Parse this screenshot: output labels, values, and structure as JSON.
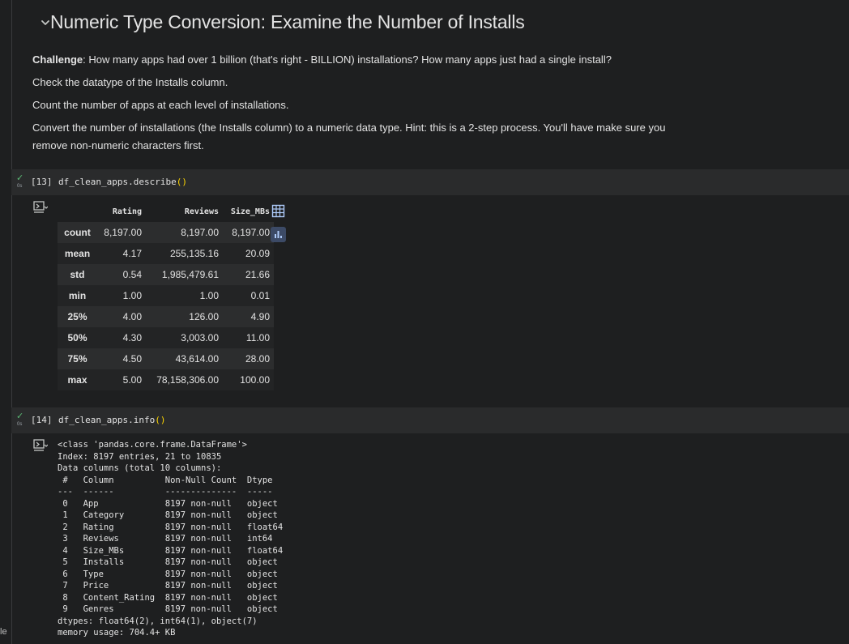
{
  "gutter_label": "le",
  "section": {
    "title": "Numeric Type Conversion: Examine the Number of Installs",
    "challenge_label": "Challenge",
    "challenge_text": ": How many apps had over 1 billion (that's right - BILLION) installations? How many apps just had a single install?",
    "para2": "Check the datatype of the Installs column.",
    "para3": "Count the number of apps at each level of installations.",
    "para4_line1": "Convert the number of installations (the Installs column) to a numeric data type. Hint: this is a 2-step process. You'll have make sure you",
    "para4_line2": "remove non-numeric characters first."
  },
  "cell13": {
    "exec_count": "[13]",
    "code_prefix": "df_clean_apps.describe",
    "paren_open": "(",
    "paren_close": ")",
    "status_secs": "0s"
  },
  "describe_table": {
    "columns": [
      "Rating",
      "Reviews",
      "Size_MBs"
    ],
    "rows": [
      {
        "label": "count",
        "values": [
          "8,197.00",
          "8,197.00",
          "8,197.00"
        ]
      },
      {
        "label": "mean",
        "values": [
          "4.17",
          "255,135.16",
          "20.09"
        ]
      },
      {
        "label": "std",
        "values": [
          "0.54",
          "1,985,479.61",
          "21.66"
        ]
      },
      {
        "label": "min",
        "values": [
          "1.00",
          "1.00",
          "0.01"
        ]
      },
      {
        "label": "25%",
        "values": [
          "4.00",
          "126.00",
          "4.90"
        ]
      },
      {
        "label": "50%",
        "values": [
          "4.30",
          "3,003.00",
          "11.00"
        ]
      },
      {
        "label": "75%",
        "values": [
          "4.50",
          "43,614.00",
          "28.00"
        ]
      },
      {
        "label": "max",
        "values": [
          "5.00",
          "78,158,306.00",
          "100.00"
        ]
      }
    ]
  },
  "cell14": {
    "exec_count": "[14]",
    "code_prefix": "df_clean_apps.info",
    "paren_open": "(",
    "paren_close": ")",
    "status_secs": "0s"
  },
  "info_output": "<class 'pandas.core.frame.DataFrame'>\nIndex: 8197 entries, 21 to 10835\nData columns (total 10 columns):\n #   Column          Non-Null Count  Dtype  \n---  ------          --------------  -----  \n 0   App             8197 non-null   object \n 1   Category        8197 non-null   object \n 2   Rating          8197 non-null   float64\n 3   Reviews         8197 non-null   int64  \n 4   Size_MBs        8197 non-null   float64\n 5   Installs        8197 non-null   object \n 6   Type            8197 non-null   object \n 7   Price           8197 non-null   object \n 8   Content_Rating  8197 non-null   object \n 9   Genres          8197 non-null   object \ndtypes: float64(2), int64(1), object(7)\nmemory usage: 704.4+ KB",
  "colors": {
    "background": "#1e1f20",
    "code_cell_bg": "#2a2b2c",
    "success_check": "#5bb974",
    "paren": "#ffd700",
    "side_button_bg": "#3c4a66",
    "side_button_icon": "#aecbfa"
  },
  "icons": {
    "collapse": "chevron-down-icon",
    "output_toggle": "output-toggle-icon",
    "table_view": "table-icon",
    "chart_suggest": "bar-chart-icon",
    "run_status": "check-icon"
  }
}
